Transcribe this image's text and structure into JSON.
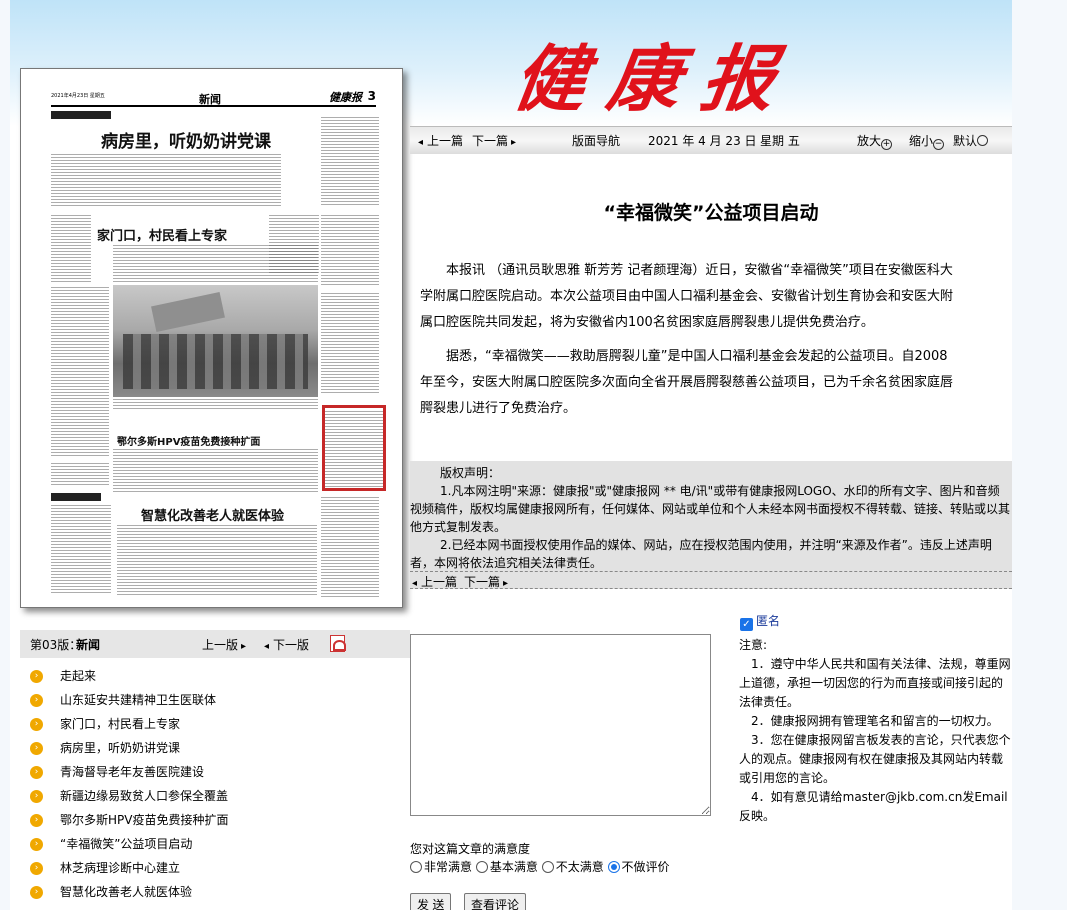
{
  "brand": {
    "logo_text": "健康报"
  },
  "newspaper_thumb": {
    "date_line": "2021年4月23日  星期五",
    "section": "新闻",
    "masthead": "健康报",
    "page_num": "3",
    "headline_1": "病房里，听奶奶讲党课",
    "headline_2": "家门口，村民看上专家",
    "headline_3": "鄂尔多斯HPV疫苗免费接种扩面",
    "headline_4": "智慧化改善老人就医体验"
  },
  "nav": {
    "prev_article": "上一篇",
    "next_article": "下一篇",
    "layout_nav": "版面导航",
    "date": "2021 年 4 月 23 日",
    "weekday": "星期 五",
    "zoom_in": "放大",
    "zoom_out": "缩小",
    "default": "默认"
  },
  "article": {
    "title": "“幸福微笑”公益项目启动",
    "paragraphs": [
      "本报讯 （通讯员耿思雅 靳芳芳 记者颜理海）近日，安徽省“幸福微笑”项目在安徽医科大学附属口腔医院启动。本次公益项目由中国人口福利基金会、安徽省计划生育协会和安医大附属口腔医院共同发起，将为安徽省内100名贫困家庭唇腭裂患儿提供免费治疗。",
      "据悉，“幸福微笑——救助唇腭裂儿童”是中国人口福利基金会发起的公益项目。自2008年至今，安医大附属口腔医院多次面向全省开展唇腭裂慈善公益项目，已为千余名贫困家庭唇腭裂患儿进行了免费治疗。"
    ]
  },
  "copyright": {
    "title": "版权声明：",
    "item_1": "1.凡本网注明\"来源：健康报\"或\"健康报网 ** 电/讯\"或带有健康报网LOGO、水印的所有文字、图片和音频视频稿件，版权均属健康报网所有，任何媒体、网站或单位和个人未经本网书面授权不得转载、链接、转贴或以其他方式复制发表。",
    "item_2": "2.已经本网书面授权使用作品的媒体、网站，应在授权范围内使用，并注明“来源及作者”。违反上述声明者，本网将依法追究相关法律责任。",
    "prev": "上一篇",
    "next": "下一篇"
  },
  "comment": {
    "anonymous_label": "匿名",
    "notice_title": "注意:",
    "notices": [
      "1．遵守中华人民共和国有关法律、法规，尊重网上道德，承担一切因您的行为而直接或间接引起的法律责任。",
      "2．健康报网拥有管理笔名和留言的一切权力。",
      "3．您在健康报网留言板发表的言论，只代表您个人的观点。健康报网有权在健康报及其网站内转载或引用您的言论。",
      "4．如有意见请给master@jkb.com.cn发Email反映。"
    ],
    "satisfaction_label": "您对这篇文章的满意度",
    "options": [
      "非常满意",
      "基本满意",
      "不太满意",
      "不做评价"
    ],
    "selected": "不做评价",
    "send_button": "发 送",
    "view_button": "查看评论"
  },
  "page_bar": {
    "page_label": "第03版：",
    "page_name": "新闻",
    "prev_page": "上一版",
    "next_page": "下一版"
  },
  "toc": [
    "走起来",
    "山东延安共建精神卫生医联体",
    "家门口，村民看上专家",
    "病房里，听奶奶讲党课",
    "青海督导老年友善医院建设",
    "新疆边缘易致贫人口参保全覆盖",
    "鄂尔多斯HPV疫苗免费接种扩面",
    "“幸福微笑”公益项目启动",
    "林芝病理诊断中心建立",
    "智慧化改善老人就医体验"
  ],
  "colors": {
    "logo_red": "#e0121b",
    "bullet": "#f0a800",
    "highlight_box": "#c62828"
  }
}
